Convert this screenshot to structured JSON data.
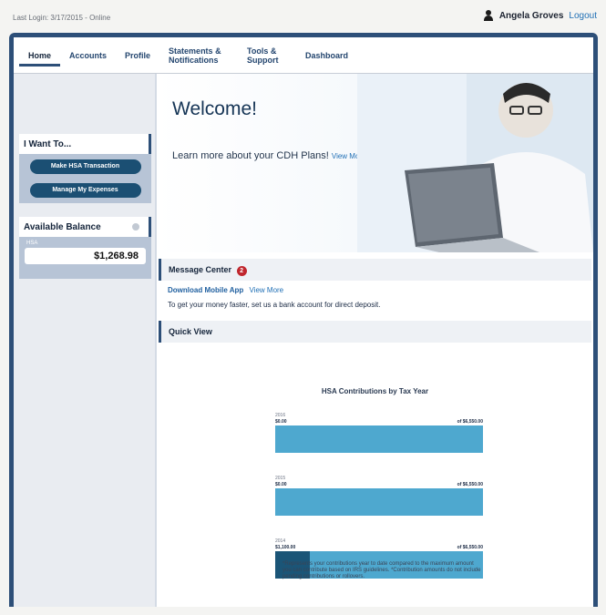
{
  "header": {
    "last_login": "Last Login: 3/17/2015 - Online",
    "user_name": "Angela Groves",
    "logout": "Logout"
  },
  "nav": {
    "items": [
      {
        "label": "Home"
      },
      {
        "label": "Accounts"
      },
      {
        "label": "Profile"
      },
      {
        "label": "Statements & Notifications"
      },
      {
        "label": "Tools & Support"
      },
      {
        "label": "Dashboard"
      }
    ],
    "active": "Home"
  },
  "sidebar": {
    "i_want_to": {
      "title": "I Want To...",
      "buttons": [
        "Make HSA Transaction",
        "Manage My Expenses"
      ]
    },
    "balance": {
      "title": "Available Balance",
      "account_label": "HSA",
      "amount": "$1,268.98"
    }
  },
  "hero": {
    "title": "Welcome!",
    "text": "Learn more about your CDH Plans!",
    "link": "View More"
  },
  "message_center": {
    "title": "Message Center",
    "count": "2",
    "line1_bold": "Download Mobile App",
    "line1_link": "View More",
    "line2": "To get your money faster, set us a bank account for direct deposit."
  },
  "quick_view": {
    "title": "Quick View"
  },
  "chart_data": {
    "type": "bar",
    "title": "HSA Contributions by Tax Year",
    "categories": [
      "2016",
      "2015",
      "2014"
    ],
    "series": [
      {
        "values": [
          0.0,
          0.0,
          1100.0
        ]
      }
    ],
    "limits": [
      6550.0,
      6550.0,
      6550.0
    ],
    "value_labels": [
      "$0.00",
      "$0.00",
      "$1,100.00"
    ],
    "limit_labels": [
      "of $6,550.00",
      "of $6,550.00",
      "of $6,550.00"
    ]
  },
  "footnote": "*Represents your contributions year to date compared to the maximum amount you can contribute based on IRS guidelines. *Contribution amounts do not include pending contributions or rollovers.",
  "colors": {
    "brand": "#2d4f78",
    "accent_button": "#1b4f73",
    "bar": "#4ea8cf",
    "bar_fill": "#1b5577",
    "badge": "#c0262d"
  }
}
